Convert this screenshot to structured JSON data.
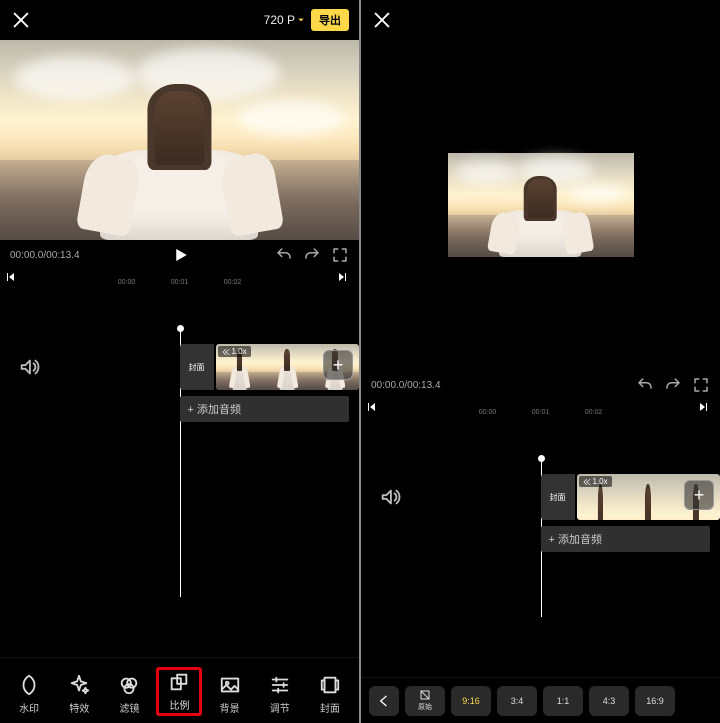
{
  "left": {
    "resolution": "720 P",
    "export_label": "导出",
    "time_display": "00:00.0/00:13.4",
    "timeline_ticks": [
      "00:00",
      "00:01",
      "00:02"
    ],
    "cover_badge": "封面",
    "speed_badge": "1.0x",
    "add_audio_label": "+ 添加音频",
    "tools": [
      {
        "label": "水印"
      },
      {
        "label": "特效"
      },
      {
        "label": "滤镜"
      },
      {
        "label": "比例"
      },
      {
        "label": "背景"
      },
      {
        "label": "调节"
      },
      {
        "label": "封面"
      }
    ]
  },
  "right": {
    "time_display": "00:00.0/00:13.4",
    "timeline_ticks": [
      "00:00",
      "00:01",
      "00:02"
    ],
    "cover_badge": "封面",
    "speed_badge": "1.0x",
    "add_audio_label": "+ 添加音频",
    "ratio_options": [
      {
        "label": "原始"
      },
      {
        "label": "9:16"
      },
      {
        "label": "3:4"
      },
      {
        "label": "1:1"
      },
      {
        "label": "4:3"
      },
      {
        "label": "16:9"
      }
    ]
  }
}
